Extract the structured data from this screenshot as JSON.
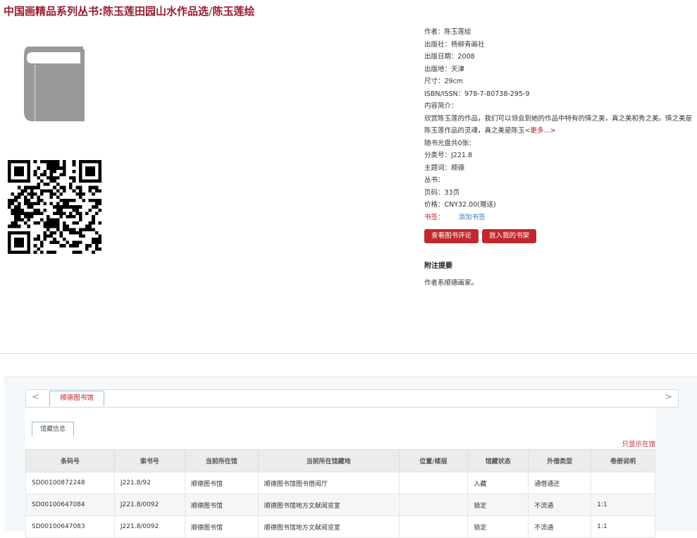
{
  "title": {
    "main": "中国画精品系列丛书:陈玉莲田园山水作品选",
    "sep": "/",
    "author": "陈玉莲绘"
  },
  "icons": {
    "cover": "book-icon",
    "qr": "qr-code-icon",
    "arrow_left": "chevron-left-icon",
    "arrow_right": "chevron-right-icon"
  },
  "info": {
    "author": "作者：陈玉莲绘",
    "publisher": "出版社：杨柳青画社",
    "date": "出版日期：2008",
    "place": "出版地：天津",
    "size": "尺寸：29cm",
    "isbn": "ISBN/ISSN：978-7-80738-295-9",
    "summary_label": "内容简介：",
    "summary": "欣赏陈玉莲的作品，我们可以领会到她的作品中特有的情之美，真之美和秀之美。情之美是陈玉莲作品的灵魂，真之美是陈玉",
    "more": "<更多...>",
    "cd": "随书光盘共0张：",
    "class_no": "分类号：J221.8",
    "subject": "主题词：顺德",
    "series": "丛书：",
    "pages": "页码：33页",
    "price": "价格：CNY32.00(赠送)",
    "bookmark_label": "书签：",
    "bookmark_link": "添加书签"
  },
  "buttons": {
    "review": "查看图书评论",
    "shelf": "放入我的书架"
  },
  "annotation": {
    "heading": "附注提要",
    "text": "作者系顺德画家。"
  },
  "holdings": {
    "arrow_left": "<",
    "arrow_right": ">",
    "tab": "顺德图书馆",
    "subtab": "馆藏信息",
    "show_all": "只显示在馆",
    "columns": [
      "条码号",
      "索书号",
      "当前所在馆",
      "当前所在馆藏地",
      "位置/楼层",
      "馆藏状态",
      "外借类型",
      "卷册说明"
    ],
    "rows": [
      [
        "SD00100872248",
        "J221.8/92",
        "顺德图书馆",
        "顺德图书馆图书借阅厅",
        "",
        "入藏",
        "通借通还",
        ""
      ],
      [
        "SD00100647084",
        "J221.8/0092",
        "顺德图书馆",
        "顺德图书馆地方文献阅览室",
        "",
        "锁定",
        "不流通",
        "1:1"
      ],
      [
        "SD00100647083",
        "J221.8/0092",
        "顺德图书馆",
        "顺德图书馆地方文献阅览室",
        "",
        "锁定",
        "不流通",
        "1:1"
      ]
    ]
  }
}
